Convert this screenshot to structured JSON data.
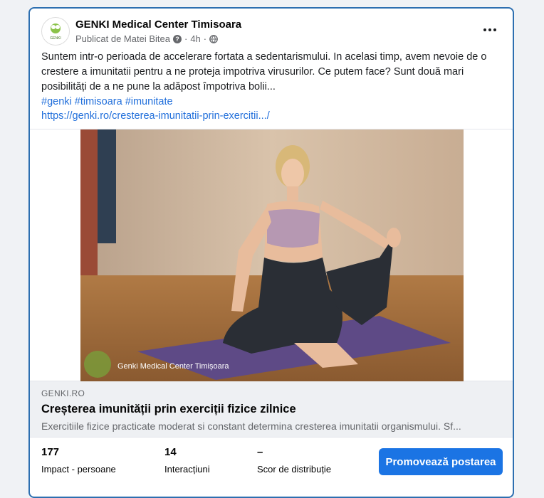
{
  "post": {
    "page_name": "GENKI Medical Center Timisoara",
    "published_by": "Publicat de Matei Bitea",
    "info_icon": "info-icon",
    "time": "4h",
    "audience_icon": "globe-icon",
    "more_icon": "more-options-icon",
    "avatar_text": "GENKI",
    "text": "Suntem intr-o perioada de accelerare fortata a sedentarismului. In acelasi timp, avem nevoie de o crestere a imunitatii pentru a ne proteja impotriva virusurilor. Ce putem face? Sunt două mari posibilități de a ne pune la adăpost împotriva bolii...",
    "hashtags": [
      "#genki",
      "#timisoara",
      "#imunitate"
    ],
    "link": "https://genki.ro/cresterea-imunitatii-prin-exercitii.../"
  },
  "media": {
    "watermark": "Genki Medical Center Timișoara"
  },
  "link_preview": {
    "domain": "GENKI.RO",
    "title": "Creșterea imunității prin exerciții fizice zilnice",
    "description": "Exercitiile fizice practicate moderat si constant determina cresterea imunitatii organismului. Sf..."
  },
  "stats": [
    {
      "value": "177",
      "label": "Impact - persoane"
    },
    {
      "value": "14",
      "label": "Interacțiuni"
    },
    {
      "value": "–",
      "label": "Scor de distribuție"
    }
  ],
  "promote_label": "Promovează postarea",
  "colors": {
    "accent": "#1b74e4",
    "link": "#216fdb",
    "card_border": "#2d6fb0"
  }
}
